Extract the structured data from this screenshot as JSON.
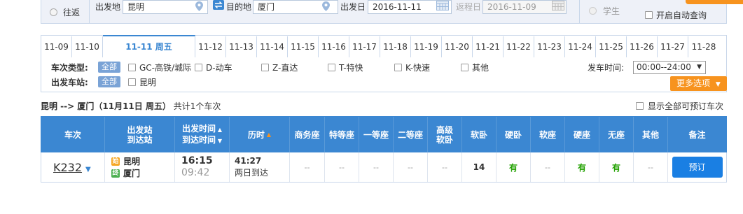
{
  "search": {
    "trip_type_label": "往返",
    "from_label": "出发地",
    "from_value": "昆明",
    "to_label": "目的地",
    "to_value": "厦门",
    "depart_label": "出发日",
    "depart_value": "2016-11-11",
    "return_label": "返程日",
    "return_value": "2016-11-09",
    "student_label": "学生",
    "auto_query_label": "开启自动查询"
  },
  "date_tabs": [
    "11-09",
    "11-10",
    "11-11  周五",
    "11-12",
    "11-13",
    "11-14",
    "11-15",
    "11-16",
    "11-17",
    "11-18",
    "11-19",
    "11-20",
    "11-21",
    "11-22",
    "11-23",
    "11-24",
    "11-25",
    "11-26",
    "11-27",
    "11-28"
  ],
  "active_tab_index": 2,
  "filters": {
    "train_type_label": "车次类型:",
    "all_label": "全部",
    "train_types": [
      "GC-高铁/城际",
      "D-动车",
      "Z-直达",
      "T-特快",
      "K-快速",
      "其他"
    ],
    "depart_station_label": "出发车站:",
    "stations": [
      "昆明"
    ],
    "depart_time_label": "发车时间:",
    "depart_time_value": "00:00--24:00",
    "more_options_label": "更多选项"
  },
  "summary": {
    "route": "昆明 --> 厦门（11月11日  周五）",
    "count_text": "共计1个车次",
    "show_all_label": "显示全部可预订车次"
  },
  "table": {
    "headers": {
      "train": "车次",
      "stations_1": "出发站",
      "stations_2": "到达站",
      "times_1": "出发时间",
      "times_2": "到达时间",
      "duration": "历时",
      "business": "商务座",
      "special": "特等座",
      "first": "一等座",
      "second": "二等座",
      "senior_1": "高级",
      "senior_2": "软卧",
      "soft_sleeper": "软卧",
      "hard_sleeper": "硬卧",
      "soft_seat": "软座",
      "hard_seat": "硬座",
      "no_seat": "无座",
      "other": "其他",
      "remark": "备注"
    },
    "rows": [
      {
        "train": "K232",
        "from_badge": "始",
        "from_station": "昆明",
        "to_badge": "终",
        "to_station": "厦门",
        "depart_time": "16:15",
        "arrive_time": "09:42",
        "duration": "41:27",
        "arrive_day": "两日到达",
        "business": "--",
        "special": "--",
        "first": "--",
        "second": "--",
        "senior": "--",
        "soft_sleeper": "14",
        "hard_sleeper": "有",
        "soft_seat": "--",
        "hard_seat": "有",
        "no_seat": "有",
        "other": "--",
        "book_label": "预订"
      }
    ]
  },
  "colors": {
    "header_blue": "#3b87d2",
    "button_blue": "#1a7fe3",
    "accent_orange": "#f7931e",
    "available_green": "#26a306",
    "origin_badge": "#f5a623",
    "dest_badge": "#4caf50"
  }
}
